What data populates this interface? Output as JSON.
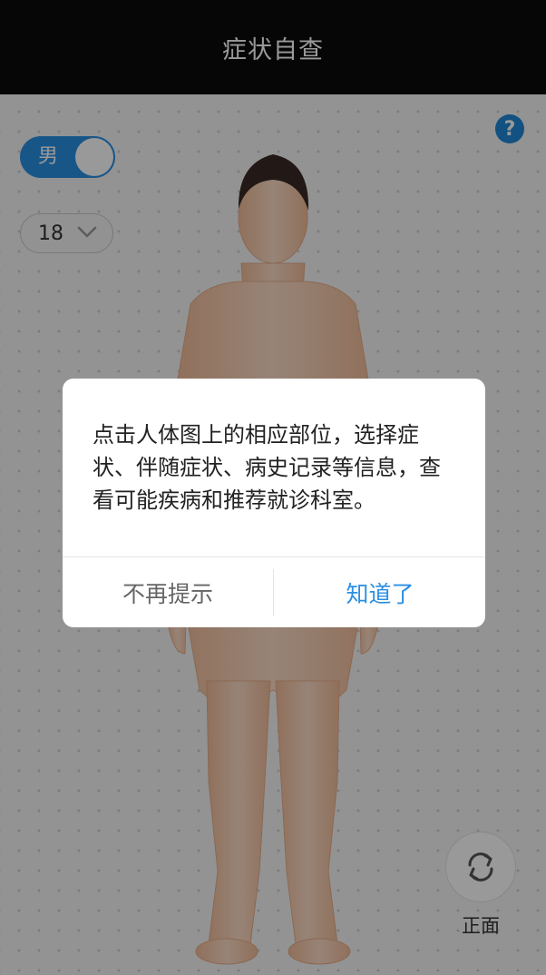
{
  "header": {
    "title": "症状自查"
  },
  "controls": {
    "gender_label": "男",
    "age_value": "18",
    "help_icon_glyph": "?"
  },
  "view": {
    "rotate_label": "正面"
  },
  "dialog": {
    "message": "点击人体图上的相应部位，选择症状、伴随症状、病史记录等信息，查看可能疾病和推荐就诊科室。",
    "dismiss_label": "不再提示",
    "ok_label": "知道了"
  },
  "colors": {
    "accent": "#2b8fe3",
    "header_bg": "#0a0a0a",
    "overlay": "rgba(0,0,0,0.40)"
  },
  "icons": [
    "help-icon",
    "chevron-down-icon",
    "rotate-icon"
  ]
}
